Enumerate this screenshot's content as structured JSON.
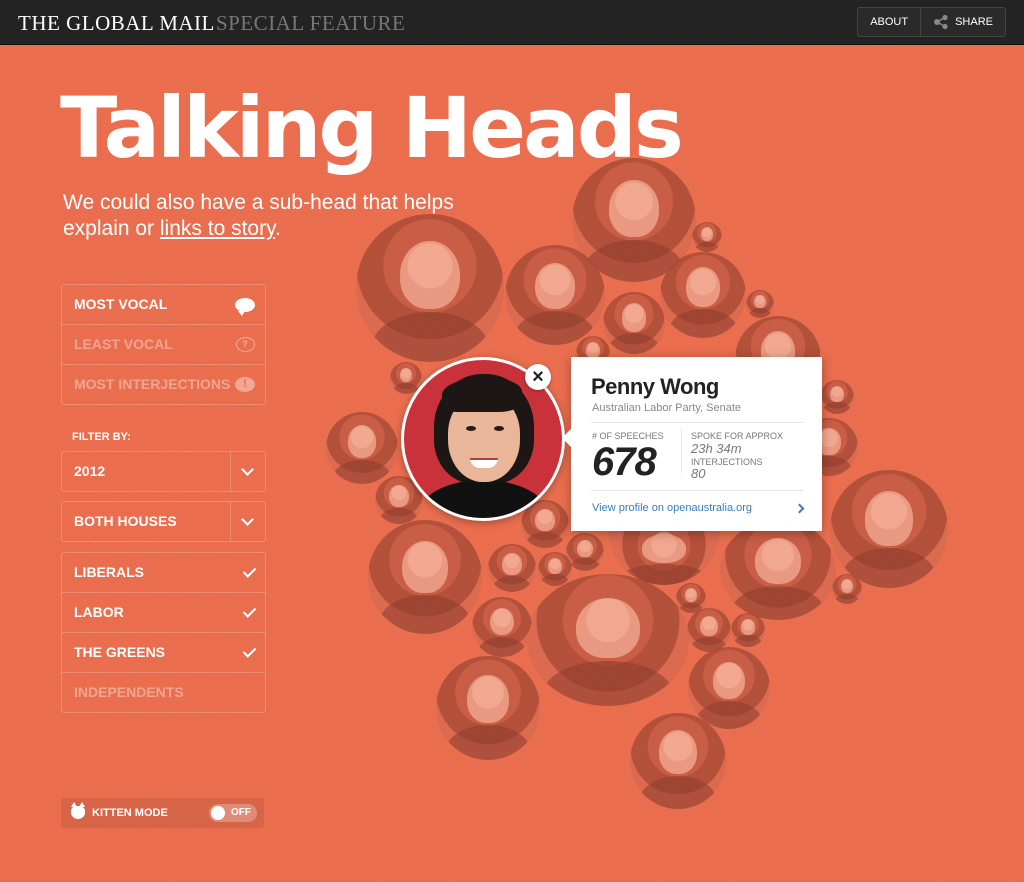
{
  "header": {
    "brand": "THE GLOBAL MAIL",
    "feature": "SPECIAL FEATURE",
    "about_label": "ABOUT",
    "share_label": "SHARE"
  },
  "title": "Talking Heads",
  "subhead": {
    "text": "We could also have a sub-head that helps explain or ",
    "link": "links to story",
    "end": "."
  },
  "sort_menu": {
    "items": [
      {
        "label": "MOST VOCAL",
        "active": true,
        "icon": "speech-bubble-icon"
      },
      {
        "label": "LEAST VOCAL",
        "active": false,
        "icon": "question-bubble-icon"
      },
      {
        "label": "MOST INTERJECTIONS",
        "active": false,
        "icon": "exclamation-bubble-icon"
      }
    ]
  },
  "filters": {
    "label": "FILTER BY:",
    "year": "2012",
    "house": "BOTH HOUSES",
    "parties": [
      {
        "label": "LIBERALS",
        "checked": true
      },
      {
        "label": "LABOR",
        "checked": true
      },
      {
        "label": "THE GREENS",
        "checked": true
      },
      {
        "label": "INDEPENDENTS",
        "checked": false
      }
    ]
  },
  "kitten": {
    "label": "KITTEN MODE",
    "state": "OFF"
  },
  "profile": {
    "name": "Penny Wong",
    "party": "Australian Labor Party, Senate",
    "speeches_label": "# OF SPEECHES",
    "speeches": "678",
    "spoke_label": "SPOKE FOR APPROX",
    "spoke_value": "23h 34m",
    "interjections_label": "INTERJECTIONS",
    "interjections_value": "80",
    "link": "View profile on openaustralia.org"
  },
  "colors": {
    "background": "#e96c4c",
    "topbar": "#232323",
    "link": "#3a7db8"
  }
}
